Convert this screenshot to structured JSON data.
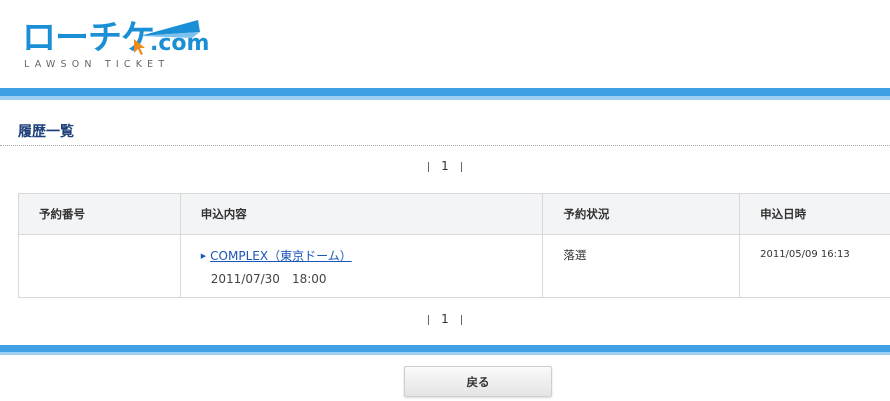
{
  "logo": {
    "main": "ローチケ",
    "com": ".com",
    "sub": "LAWSON TICKET"
  },
  "page": {
    "title": "履歴一覧"
  },
  "pagination": {
    "current_page": "1"
  },
  "table": {
    "headers": [
      "予約番号",
      "申込内容",
      "予約状況",
      "申込日時"
    ],
    "rows": [
      {
        "reservation_no": "",
        "event_name": "COMPLEX（東京ドーム）",
        "event_datetime": "2011/07/30　18:00",
        "status": "落選",
        "applied_at": "2011/05/09 16:13"
      }
    ]
  },
  "buttons": {
    "back": "戻る"
  },
  "colors": {
    "accent_blue": "#3fa0e4",
    "title_navy": "#1d3f7a",
    "link_blue": "#1a55b8"
  }
}
